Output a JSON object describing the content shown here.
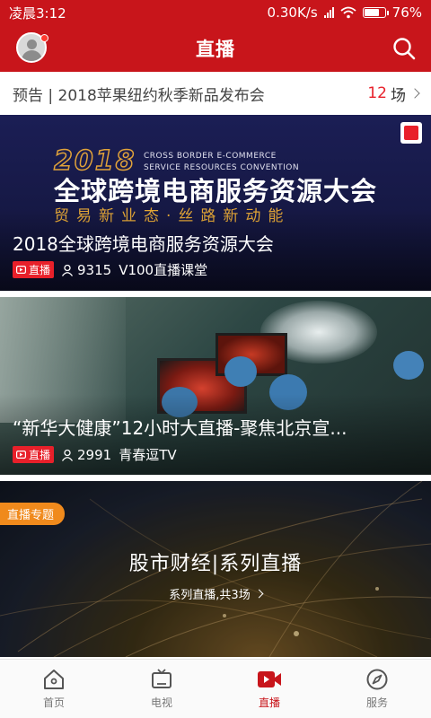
{
  "status_bar": {
    "time": "凌晨3:12",
    "network_speed": "0.30K/s",
    "battery": "76%",
    "battery_level": 0.76
  },
  "header": {
    "title": "直播",
    "avatar_icon": "user-avatar-icon",
    "search_icon": "search-icon"
  },
  "preview": {
    "text": "预告 | 2018苹果纽约秋季新品发布会",
    "count": "12",
    "unit": "场"
  },
  "cards": [
    {
      "banner_year": "2018",
      "banner_en_line1": "CROSS BORDER E-COMMERCE",
      "banner_en_line2": "SERVICE RESOURCES CONVENTION",
      "banner_zh": "全球跨境电商服务资源大会",
      "banner_sub": "贸易新业态·丝路新动能",
      "title": "2018全球跨境电商服务资源大会",
      "live_label": "直播",
      "viewers": "9315",
      "channel": "V100直播课堂"
    },
    {
      "title": "“新华大健康”12小时大直播-聚焦北京宣...",
      "live_label": "直播",
      "viewers": "2991",
      "channel": "青春逗TV"
    }
  ],
  "topic": {
    "badge": "直播专题",
    "title": "股市财经|系列直播",
    "subtitle": "系列直播,共3场"
  },
  "nav": [
    {
      "label": "首页",
      "icon": "home-icon",
      "active": false
    },
    {
      "label": "电视",
      "icon": "tv-icon",
      "active": false
    },
    {
      "label": "直播",
      "icon": "video-camera-icon",
      "active": true
    },
    {
      "label": "服务",
      "icon": "compass-icon",
      "active": false
    }
  ],
  "colors": {
    "brand_red": "#c8151b",
    "live_tag": "#e8202a",
    "topic_badge": "#f08a1c",
    "banner_gold": "#e3a637"
  }
}
